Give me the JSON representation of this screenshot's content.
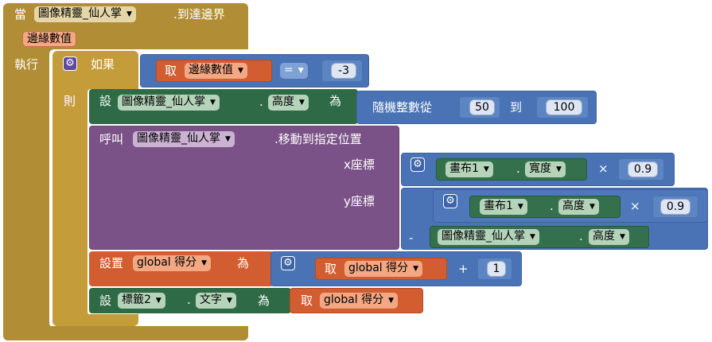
{
  "event": {
    "when": "當",
    "component": "圖像精靈_仙人掌",
    "event_name": ".到達邊界",
    "param": "邊緣數值",
    "do": "執行"
  },
  "if_block": {
    "if": "如果",
    "then": "則",
    "get": "取",
    "var": "邊緣數值",
    "op": "=",
    "value": "-3"
  },
  "set_height": {
    "set": "設",
    "component": "圖像精靈_仙人掌",
    "prop": "高度",
    "to": "為",
    "random": "隨機整數從",
    "from": "50",
    "to_word": "到",
    "to_value": "100"
  },
  "call_move": {
    "call": "呼叫",
    "component": "圖像精靈_仙人掌",
    "method": ".移動到指定位置",
    "x_label": "x座標",
    "y_label": "y座標",
    "x_canvas": "畫布1",
    "x_prop": "寬度",
    "x_mult": "×",
    "x_factor": "0.9",
    "y_canvas": "畫布1",
    "y_prop": "高度",
    "y_mult": "×",
    "y_factor": "0.9",
    "minus": "-",
    "sub_component": "圖像精靈_仙人掌",
    "sub_prop": "高度"
  },
  "set_score": {
    "set": "設置",
    "var": "global 得分",
    "to": "為",
    "get": "取",
    "get_var": "global 得分",
    "plus": "+",
    "value": "1"
  },
  "set_label": {
    "set": "設",
    "component": "標籤2",
    "prop": "文字",
    "to": "為",
    "get": "取",
    "get_var": "global 得分"
  },
  "icons": {
    "gear": "⚙",
    "dropdown": "▼"
  },
  "colors": {
    "event": "#b18e35",
    "control": "#c59c3a",
    "math": "#4a73b5",
    "variable": "#d25d31",
    "component": "#34704b",
    "procedure": "#7b5287"
  }
}
